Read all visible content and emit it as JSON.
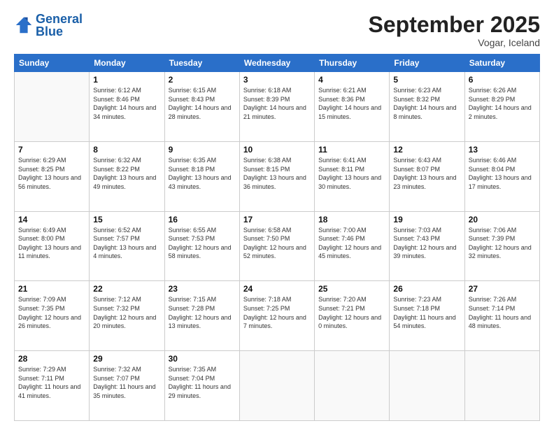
{
  "header": {
    "logo_line1": "General",
    "logo_line2": "Blue",
    "month": "September 2025",
    "location": "Vogar, Iceland"
  },
  "weekdays": [
    "Sunday",
    "Monday",
    "Tuesday",
    "Wednesday",
    "Thursday",
    "Friday",
    "Saturday"
  ],
  "weeks": [
    [
      {
        "day": "",
        "sunrise": "",
        "sunset": "",
        "daylight": ""
      },
      {
        "day": "1",
        "sunrise": "Sunrise: 6:12 AM",
        "sunset": "Sunset: 8:46 PM",
        "daylight": "Daylight: 14 hours and 34 minutes."
      },
      {
        "day": "2",
        "sunrise": "Sunrise: 6:15 AM",
        "sunset": "Sunset: 8:43 PM",
        "daylight": "Daylight: 14 hours and 28 minutes."
      },
      {
        "day": "3",
        "sunrise": "Sunrise: 6:18 AM",
        "sunset": "Sunset: 8:39 PM",
        "daylight": "Daylight: 14 hours and 21 minutes."
      },
      {
        "day": "4",
        "sunrise": "Sunrise: 6:21 AM",
        "sunset": "Sunset: 8:36 PM",
        "daylight": "Daylight: 14 hours and 15 minutes."
      },
      {
        "day": "5",
        "sunrise": "Sunrise: 6:23 AM",
        "sunset": "Sunset: 8:32 PM",
        "daylight": "Daylight: 14 hours and 8 minutes."
      },
      {
        "day": "6",
        "sunrise": "Sunrise: 6:26 AM",
        "sunset": "Sunset: 8:29 PM",
        "daylight": "Daylight: 14 hours and 2 minutes."
      }
    ],
    [
      {
        "day": "7",
        "sunrise": "Sunrise: 6:29 AM",
        "sunset": "Sunset: 8:25 PM",
        "daylight": "Daylight: 13 hours and 56 minutes."
      },
      {
        "day": "8",
        "sunrise": "Sunrise: 6:32 AM",
        "sunset": "Sunset: 8:22 PM",
        "daylight": "Daylight: 13 hours and 49 minutes."
      },
      {
        "day": "9",
        "sunrise": "Sunrise: 6:35 AM",
        "sunset": "Sunset: 8:18 PM",
        "daylight": "Daylight: 13 hours and 43 minutes."
      },
      {
        "day": "10",
        "sunrise": "Sunrise: 6:38 AM",
        "sunset": "Sunset: 8:15 PM",
        "daylight": "Daylight: 13 hours and 36 minutes."
      },
      {
        "day": "11",
        "sunrise": "Sunrise: 6:41 AM",
        "sunset": "Sunset: 8:11 PM",
        "daylight": "Daylight: 13 hours and 30 minutes."
      },
      {
        "day": "12",
        "sunrise": "Sunrise: 6:43 AM",
        "sunset": "Sunset: 8:07 PM",
        "daylight": "Daylight: 13 hours and 23 minutes."
      },
      {
        "day": "13",
        "sunrise": "Sunrise: 6:46 AM",
        "sunset": "Sunset: 8:04 PM",
        "daylight": "Daylight: 13 hours and 17 minutes."
      }
    ],
    [
      {
        "day": "14",
        "sunrise": "Sunrise: 6:49 AM",
        "sunset": "Sunset: 8:00 PM",
        "daylight": "Daylight: 13 hours and 11 minutes."
      },
      {
        "day": "15",
        "sunrise": "Sunrise: 6:52 AM",
        "sunset": "Sunset: 7:57 PM",
        "daylight": "Daylight: 13 hours and 4 minutes."
      },
      {
        "day": "16",
        "sunrise": "Sunrise: 6:55 AM",
        "sunset": "Sunset: 7:53 PM",
        "daylight": "Daylight: 12 hours and 58 minutes."
      },
      {
        "day": "17",
        "sunrise": "Sunrise: 6:58 AM",
        "sunset": "Sunset: 7:50 PM",
        "daylight": "Daylight: 12 hours and 52 minutes."
      },
      {
        "day": "18",
        "sunrise": "Sunrise: 7:00 AM",
        "sunset": "Sunset: 7:46 PM",
        "daylight": "Daylight: 12 hours and 45 minutes."
      },
      {
        "day": "19",
        "sunrise": "Sunrise: 7:03 AM",
        "sunset": "Sunset: 7:43 PM",
        "daylight": "Daylight: 12 hours and 39 minutes."
      },
      {
        "day": "20",
        "sunrise": "Sunrise: 7:06 AM",
        "sunset": "Sunset: 7:39 PM",
        "daylight": "Daylight: 12 hours and 32 minutes."
      }
    ],
    [
      {
        "day": "21",
        "sunrise": "Sunrise: 7:09 AM",
        "sunset": "Sunset: 7:35 PM",
        "daylight": "Daylight: 12 hours and 26 minutes."
      },
      {
        "day": "22",
        "sunrise": "Sunrise: 7:12 AM",
        "sunset": "Sunset: 7:32 PM",
        "daylight": "Daylight: 12 hours and 20 minutes."
      },
      {
        "day": "23",
        "sunrise": "Sunrise: 7:15 AM",
        "sunset": "Sunset: 7:28 PM",
        "daylight": "Daylight: 12 hours and 13 minutes."
      },
      {
        "day": "24",
        "sunrise": "Sunrise: 7:18 AM",
        "sunset": "Sunset: 7:25 PM",
        "daylight": "Daylight: 12 hours and 7 minutes."
      },
      {
        "day": "25",
        "sunrise": "Sunrise: 7:20 AM",
        "sunset": "Sunset: 7:21 PM",
        "daylight": "Daylight: 12 hours and 0 minutes."
      },
      {
        "day": "26",
        "sunrise": "Sunrise: 7:23 AM",
        "sunset": "Sunset: 7:18 PM",
        "daylight": "Daylight: 11 hours and 54 minutes."
      },
      {
        "day": "27",
        "sunrise": "Sunrise: 7:26 AM",
        "sunset": "Sunset: 7:14 PM",
        "daylight": "Daylight: 11 hours and 48 minutes."
      }
    ],
    [
      {
        "day": "28",
        "sunrise": "Sunrise: 7:29 AM",
        "sunset": "Sunset: 7:11 PM",
        "daylight": "Daylight: 11 hours and 41 minutes."
      },
      {
        "day": "29",
        "sunrise": "Sunrise: 7:32 AM",
        "sunset": "Sunset: 7:07 PM",
        "daylight": "Daylight: 11 hours and 35 minutes."
      },
      {
        "day": "30",
        "sunrise": "Sunrise: 7:35 AM",
        "sunset": "Sunset: 7:04 PM",
        "daylight": "Daylight: 11 hours and 29 minutes."
      },
      {
        "day": "",
        "sunrise": "",
        "sunset": "",
        "daylight": ""
      },
      {
        "day": "",
        "sunrise": "",
        "sunset": "",
        "daylight": ""
      },
      {
        "day": "",
        "sunrise": "",
        "sunset": "",
        "daylight": ""
      },
      {
        "day": "",
        "sunrise": "",
        "sunset": "",
        "daylight": ""
      }
    ]
  ]
}
